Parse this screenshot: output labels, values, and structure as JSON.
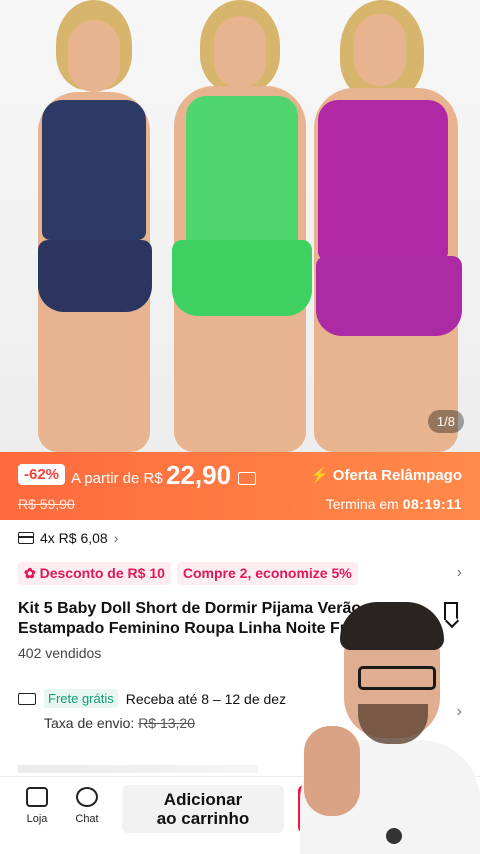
{
  "gallery": {
    "counter": "1/8"
  },
  "flash": {
    "discount_badge": "-62%",
    "from_label": "A partir de R$",
    "price": "22,90",
    "old_price": "R$ 59,90",
    "offer_label": "Oferta Relâmpago",
    "ends_label": "Termina em",
    "countdown": "08:19:11"
  },
  "installments": {
    "text": "4x R$ 6,08",
    "chevron": "›"
  },
  "promos": [
    {
      "label": "Desconto de R$ 10"
    },
    {
      "label": "Compre 2, economize 5%"
    }
  ],
  "product": {
    "title_line1": "Kit 5 Baby Doll Short de Dormir Pijama Verão",
    "title_line2": "Estampado Feminino Roupa Linha Noite Fres",
    "sold": "402 vendidos"
  },
  "shipping": {
    "free_label": "Frete grátis",
    "delivery": "Receba até 8 – 12 de dez",
    "fee_label": "Taxa de envio:",
    "fee_old": "R$ 13,20"
  },
  "bottom_bar": {
    "store_label": "Loja",
    "chat_label": "Chat",
    "add_cart_line1": "Adicionar",
    "add_cart_line2": "ao carrinho"
  },
  "colors": {
    "flash_start": "#ff6a3d",
    "flash_end": "#ff8a4a",
    "promo_text": "#e0185a",
    "free_ship": "#0f9d75",
    "buy_button": "#f0173f"
  }
}
